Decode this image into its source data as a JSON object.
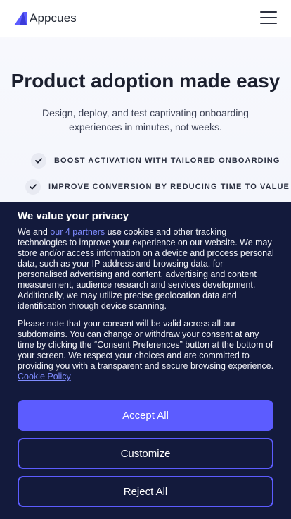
{
  "header": {
    "logo_text": "Appcues",
    "menu_icon": "hamburger-menu-icon"
  },
  "hero": {
    "title": "Product adoption made easy",
    "subtitle": "Design, deploy, and test captivating onboarding experiences in minutes, not weeks.",
    "features": [
      "BOOST ACTIVATION WITH TAILORED ONBOARDING",
      "IMPROVE CONVERSION BY REDUCING TIME TO VALUE"
    ]
  },
  "consent": {
    "title": "We value your privacy",
    "p1_before": "We and ",
    "p1_link": "our 4 partners",
    "p1_after": " use cookies and other tracking technologies to improve your experience on our website. We may store and/or access information on a device and process personal data, such as your IP address and browsing data, for personalised advertising and content, advertising and content measurement, audience research and services development. Additionally, we may utilize precise geolocation data and identification through device scanning.",
    "p2_text": "Please note that your consent will be valid across all our subdomains. You can change or withdraw your consent at any time by clicking the “Consent Preferences” button at the bottom of your screen. We respect your choices and are committed to providing you with a transparent and secure browsing experience. ",
    "p2_link": "Cookie Policy",
    "accept_label": "Accept All",
    "customize_label": "Customize",
    "reject_label": "Reject All"
  },
  "colors": {
    "brand": "#5c5cff",
    "banner_bg": "#131a3c",
    "link": "#7f8cff"
  }
}
